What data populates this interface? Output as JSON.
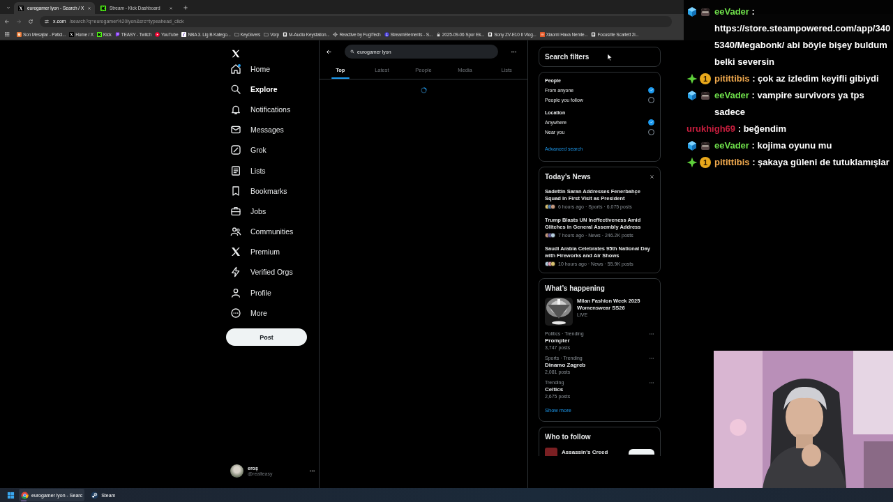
{
  "browser": {
    "tabs": [
      {
        "title": "eurogamer lyon - Search / X",
        "kind": "x",
        "selected": true
      },
      {
        "title": "Stream - Kick Dashboard",
        "kind": "kick",
        "selected": false
      }
    ],
    "address": {
      "host": "x.com",
      "path": "/search?q=eurogamer%20lyon&src=typeahead_click"
    },
    "bookmarks": [
      {
        "label": "Son Mesajlar - Patici...",
        "kind": "cat"
      },
      {
        "label": "Home / X",
        "kind": "x"
      },
      {
        "label": "Kick",
        "kind": "kick"
      },
      {
        "label": "TEASY - Twitch",
        "kind": "twitch"
      },
      {
        "label": "YouTube",
        "kind": "youtube"
      },
      {
        "label": "NBA 3. Lig B Katego...",
        "kind": "slash"
      },
      {
        "label": "KeyGivers",
        "kind": "folder"
      },
      {
        "label": "Vorp",
        "kind": "folder"
      },
      {
        "label": "M-Audio Keystation...",
        "kind": "doc"
      },
      {
        "label": "Reactive by FugiTech",
        "kind": "gear"
      },
      {
        "label": "StreamElements - S...",
        "kind": "anchor"
      },
      {
        "label": "2025-09-06 Spor Ek...",
        "kind": "lock"
      },
      {
        "label": "Sony ZV-E10 II Vlog...",
        "kind": "doc"
      },
      {
        "label": "Xiaomi Hava Nemle...",
        "kind": "hb"
      },
      {
        "label": "Focusrite Scarlett 2i...",
        "kind": "doc"
      }
    ]
  },
  "nav": {
    "items": [
      {
        "label": "Home",
        "kind": "home",
        "selected": false,
        "badge": true
      },
      {
        "label": "Explore",
        "kind": "search",
        "selected": true,
        "badge": false
      },
      {
        "label": "Notifications",
        "kind": "bell",
        "selected": false,
        "badge": false
      },
      {
        "label": "Messages",
        "kind": "mail",
        "selected": false,
        "badge": false
      },
      {
        "label": "Grok",
        "kind": "grok",
        "selected": false,
        "badge": false
      },
      {
        "label": "Lists",
        "kind": "list",
        "selected": false,
        "badge": false
      },
      {
        "label": "Bookmarks",
        "kind": "bookmark",
        "selected": false,
        "badge": false
      },
      {
        "label": "Jobs",
        "kind": "briefcase",
        "selected": false,
        "badge": false
      },
      {
        "label": "Communities",
        "kind": "people",
        "selected": false,
        "badge": false
      },
      {
        "label": "Premium",
        "kind": "x",
        "selected": false,
        "badge": false
      },
      {
        "label": "Verified Orgs",
        "kind": "bolt",
        "selected": false,
        "badge": false
      },
      {
        "label": "Profile",
        "kind": "person",
        "selected": false,
        "badge": false
      },
      {
        "label": "More",
        "kind": "more",
        "selected": false,
        "badge": false
      }
    ],
    "post": "Post",
    "account": {
      "name": "eroş",
      "handle": "@realteasy"
    }
  },
  "center": {
    "search": {
      "value": "eurogamer lyon"
    },
    "tabs": [
      {
        "label": "Top",
        "selected": true
      },
      {
        "label": "Latest",
        "selected": false
      },
      {
        "label": "People",
        "selected": false
      },
      {
        "label": "Media",
        "selected": false
      },
      {
        "label": "Lists",
        "selected": false
      }
    ],
    "loading": true
  },
  "right": {
    "search_filters": {
      "title": "Search filters",
      "groups": [
        {
          "heading": "People",
          "options": [
            {
              "label": "From anyone",
              "selected": true
            },
            {
              "label": "People you follow",
              "selected": false
            }
          ]
        },
        {
          "heading": "Location",
          "options": [
            {
              "label": "Anywhere",
              "selected": true
            },
            {
              "label": "Near you",
              "selected": false
            }
          ]
        }
      ],
      "link": "Advanced search"
    },
    "news": {
      "title": "Today’s News",
      "items": [
        {
          "title": "Sadettin Saran Addresses Fenerbahçe Squad in First Visit as President",
          "meta": "6 hours ago · Sports · 6,075 posts"
        },
        {
          "title": "Trump Blasts UN Ineffectiveness Amid Glitches in General Assembly Address",
          "meta": "7 hours ago · News · 246.2K posts"
        },
        {
          "title": "Saudi Arabia Celebrates 95th National Day with Fireworks and Air Shows",
          "meta": "10 hours ago · News · 55.9K posts"
        }
      ]
    },
    "happening": {
      "title": "What’s happening",
      "featured": {
        "title": "Milan Fashion Week 2025 Womenswear SS26",
        "status": "LIVE"
      },
      "trends": [
        {
          "context": "Politics · Trending",
          "name": "Prompter",
          "posts": "3,747 posts"
        },
        {
          "context": "Sports · Trending",
          "name": "Dinamo Zagreb",
          "posts": "2,081 posts"
        },
        {
          "context": "Trending",
          "name": "Celtics",
          "posts": "2,675 posts"
        }
      ],
      "more": "Show more"
    },
    "follow": {
      "title": "Who to follow",
      "accounts": [
        {
          "name": "Assassin's Creed"
        }
      ]
    }
  },
  "chat": {
    "messages": [
      {
        "user": "eeVader",
        "color": "#6fe04b",
        "badges": [
          {
            "kind": "cube"
          },
          {
            "kind": "mask"
          }
        ],
        "text": ": https://store.steampowered.com/app/3405340/Megabonk/ abi böyle bişey buldum belki seversin"
      },
      {
        "user": "pitittibis",
        "color": "#f0a94e",
        "badges": [
          {
            "kind": "sparkle"
          },
          {
            "kind": "coin",
            "label": "1"
          }
        ],
        "text": ": çok az izledim keyifli gibiydi"
      },
      {
        "user": "eeVader",
        "color": "#6fe04b",
        "badges": [
          {
            "kind": "cube"
          },
          {
            "kind": "mask"
          }
        ],
        "text": ": vampire survivors ya tps sadece"
      },
      {
        "user": "urukhigh69",
        "color": "#c81e3e",
        "text": ": beğendim"
      },
      {
        "user": "eeVader",
        "color": "#6fe04b",
        "badges": [
          {
            "kind": "cube"
          },
          {
            "kind": "mask"
          }
        ],
        "text": ": kojima oyunu mu"
      },
      {
        "user": "pitittibis",
        "color": "#f0a94e",
        "badges": [
          {
            "kind": "sparkle"
          },
          {
            "kind": "coin",
            "label": "1"
          }
        ],
        "text": ": şakaya güleni de tutuklamışlar"
      }
    ]
  },
  "taskbar": {
    "apps": [
      {
        "label": "eurogamer lyon - Searc",
        "kind": "chrome",
        "selected": true
      },
      {
        "label": "Steam",
        "kind": "steam",
        "selected": false
      }
    ]
  }
}
